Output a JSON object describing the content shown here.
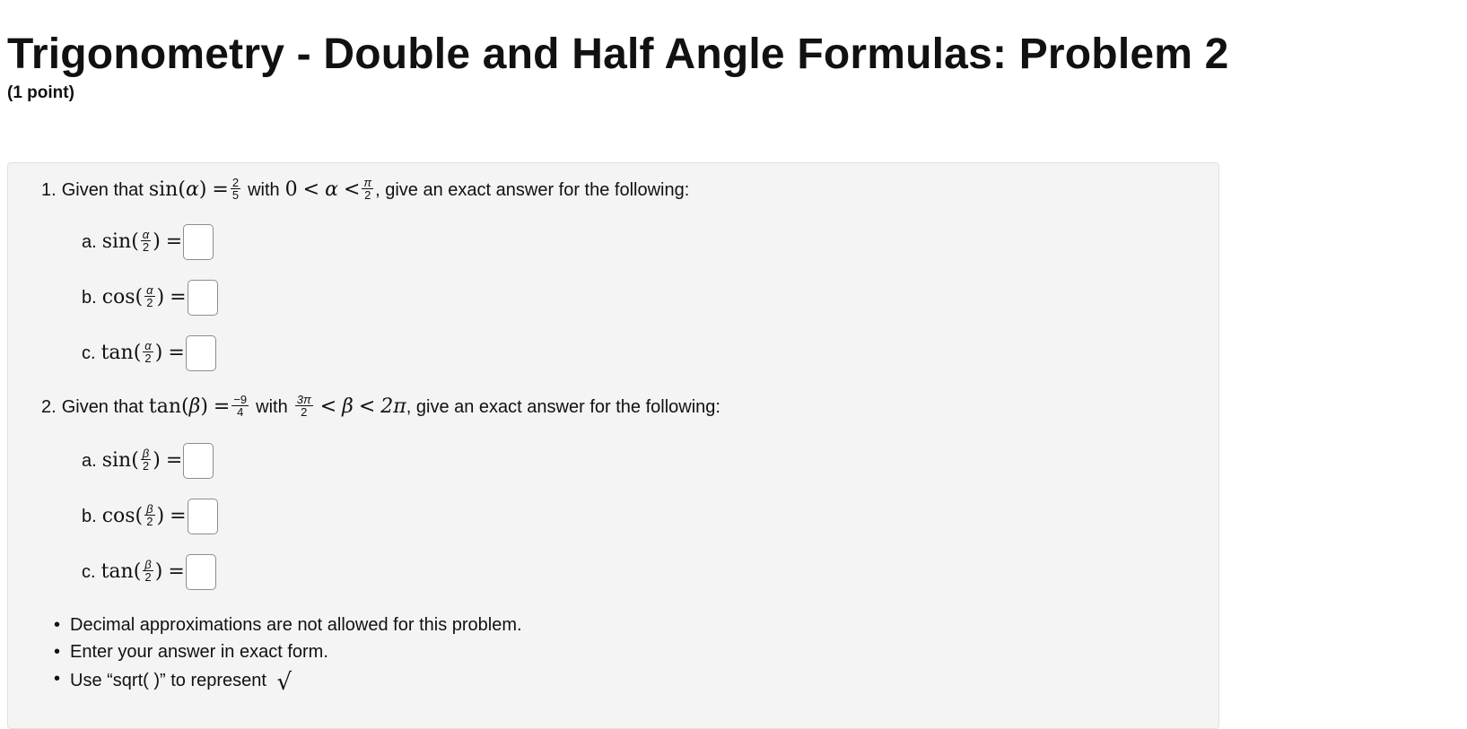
{
  "header": {
    "title": "Trigonometry - Double and Half Angle Formulas: Problem 2",
    "points": "(1 point)"
  },
  "question1": {
    "number": "1.",
    "given_text": "Given that",
    "func": "sin",
    "var": "α",
    "eq": "=",
    "value_num": "2",
    "value_den": "5",
    "with_text": "with",
    "range_low": "0",
    "lt": "<",
    "range_high_num": "π",
    "range_high_den": "2",
    "tail": ", give an exact answer for the following:",
    "parts": [
      {
        "label": "a.",
        "func": "sin",
        "num": "α",
        "den": "2"
      },
      {
        "label": "b.",
        "func": "cos",
        "num": "α",
        "den": "2"
      },
      {
        "label": "c.",
        "func": "tan",
        "num": "α",
        "den": "2"
      }
    ]
  },
  "question2": {
    "number": "2.",
    "given_text": "Given that",
    "func": "tan",
    "var": "β",
    "eq": "=",
    "value_num": "−9",
    "value_den": "4",
    "with_text": "with",
    "range_low_num": "3π",
    "range_low_den": "2",
    "lt": "<",
    "range_high": "2π",
    "tail": ", give an exact answer for the following:",
    "parts": [
      {
        "label": "a.",
        "func": "sin",
        "num": "β",
        "den": "2"
      },
      {
        "label": "b.",
        "func": "cos",
        "num": "β",
        "den": "2"
      },
      {
        "label": "c.",
        "func": "tan",
        "num": "β",
        "den": "2"
      }
    ]
  },
  "notes": [
    "Decimal approximations are not allowed for this problem.",
    "Enter your answer in exact form.",
    "Use “sqrt( )” to represent"
  ],
  "bullet": "•",
  "sqrt_symbol": "√",
  "paren_open": "(",
  "paren_close": ")"
}
